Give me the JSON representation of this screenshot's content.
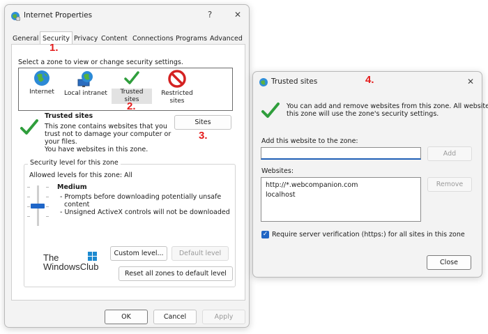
{
  "colors": {
    "accent": "#1f66c8",
    "annotation": "#e41b1b",
    "check": "#2f9e3c"
  },
  "internet_properties": {
    "title": "Internet Properties",
    "help_label": "?",
    "close_label": "✕",
    "tabs": [
      {
        "label": "General"
      },
      {
        "label": "Security"
      },
      {
        "label": "Privacy"
      },
      {
        "label": "Content"
      },
      {
        "label": "Connections"
      },
      {
        "label": "Programs"
      },
      {
        "label": "Advanced"
      }
    ],
    "zone_prompt": "Select a zone to view or change security settings.",
    "zones": [
      {
        "label": "Internet",
        "icon": "globe-icon"
      },
      {
        "label": "Local intranet",
        "icon": "monitor-globe-icon"
      },
      {
        "label": "Trusted sites",
        "icon": "checkmark-icon"
      },
      {
        "label": "Restricted sites",
        "icon": "no-entry-icon"
      }
    ],
    "zone_info": {
      "title": "Trusted sites",
      "line1": "This zone contains websites that you",
      "line2": "trust not to damage your computer or",
      "line3": "your files.",
      "line4": "You have websites in this zone."
    },
    "sites_button": "Sites",
    "security_level": {
      "group_title": "Security level for this zone",
      "allowed": "Allowed levels for this zone: All",
      "level": "Medium",
      "desc1": "- Prompts before downloading potentially unsafe",
      "desc2": "content",
      "desc3": "- Unsigned ActiveX controls will not be downloaded"
    },
    "custom_level": "Custom level...",
    "default_level": "Default level",
    "reset_all": "Reset all zones to default level",
    "ok": "OK",
    "cancel": "Cancel",
    "apply": "Apply"
  },
  "watermark": {
    "line1": "The",
    "line2": "WindowsClub"
  },
  "annotations": {
    "a1": "1.",
    "a2": "2.",
    "a3": "3.",
    "a4": "4."
  },
  "trusted_sites": {
    "title": "Trusted sites",
    "close_label": "✕",
    "info1": "You can add and remove websites from this zone. All websites in",
    "info2": "this zone will use the zone's security settings.",
    "add_label": "Add this website to the zone:",
    "add_value": "",
    "add_button": "Add",
    "websites_label": "Websites:",
    "websites": [
      "http://*.webcompanion.com",
      "localhost"
    ],
    "remove_button": "Remove",
    "require_verification": "Require server verification (https:) for all sites in this zone",
    "close_button": "Close"
  }
}
